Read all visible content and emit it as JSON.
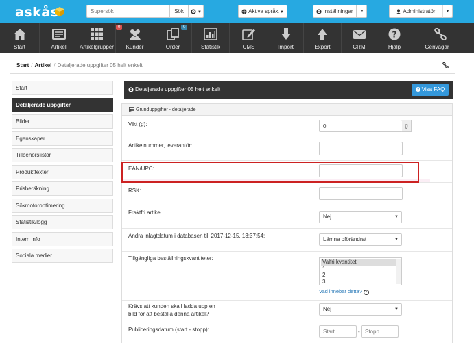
{
  "brand": {
    "name": "askås"
  },
  "topbar": {
    "search_placeholder": "Supersök",
    "search_button": "Sök",
    "language_button": "Aktiva språk",
    "settings_button": "Inställningar",
    "admin_button": "Administratör"
  },
  "nav": {
    "items": [
      {
        "label": "Start",
        "icon": "home-icon"
      },
      {
        "label": "Artikel",
        "icon": "article-icon"
      },
      {
        "label": "Artikelgrupper",
        "icon": "grid-icon"
      },
      {
        "label": "Kunder",
        "icon": "customers-icon",
        "badge": "0"
      },
      {
        "label": "Order",
        "icon": "orders-icon",
        "badge": "0"
      },
      {
        "label": "Statistik",
        "icon": "chart-icon"
      },
      {
        "label": "CMS",
        "icon": "edit-icon"
      },
      {
        "label": "Import",
        "icon": "import-arrow-icon"
      },
      {
        "label": "Export",
        "icon": "export-arrow-icon"
      },
      {
        "label": "CRM",
        "icon": "envelope-icon"
      },
      {
        "label": "Hjälp",
        "icon": "help-icon"
      },
      {
        "label": "Genvägar",
        "icon": "link-icon"
      }
    ],
    "badge_colors": {
      "kunder": "#d9534f",
      "order": "#3a87ad"
    }
  },
  "breadcrumb": {
    "start": "Start",
    "article": "Artikel",
    "separator": "/",
    "current": "Detaljerade uppgifter 05 helt enkelt"
  },
  "sidebar": {
    "items": [
      {
        "label": "Start"
      },
      {
        "label": "Detaljerade uppgifter",
        "active": true
      },
      {
        "label": "Bilder"
      },
      {
        "label": "Egenskaper"
      },
      {
        "label": "Tillbehörslistor"
      },
      {
        "label": "Produkttexter"
      },
      {
        "label": "Prisberäkning"
      },
      {
        "label": "Sökmotoroptimering"
      },
      {
        "label": "Statistik/logg"
      },
      {
        "label": "Intern info"
      },
      {
        "label": "Sociala medier"
      }
    ]
  },
  "main": {
    "header_title": "Detaljerade uppgifter 05 helt enkelt",
    "faq_button": "Visa FAQ",
    "section_title": "Grunduppgifter - detaljerade",
    "fields": {
      "weight": {
        "label": "Vikt (g):",
        "value": "0",
        "unit": "g"
      },
      "article_number": {
        "label": "Artikelnummer, leverantör:",
        "value": ""
      },
      "ean": {
        "label": "EAN/UPC:",
        "value": ""
      },
      "rsk": {
        "label": "RSK:",
        "value": ""
      },
      "free_shipping": {
        "label": "Fraktfri artikel",
        "value": "Nej"
      },
      "change_date": {
        "label": "Ändra inlagtdatum i databasen till 2017-12-15, 13:37:54:",
        "value": "Lämna oförändrat"
      },
      "quantities": {
        "label": "Tillgängliga beställningskvantiteter:",
        "options": [
          "Valfri kvantitet",
          "1",
          "2",
          "3"
        ],
        "selected": "Valfri kvantitet",
        "help_link": "Vad innebär detta?"
      },
      "upload": {
        "label_line1": "Krävs att kunden skall ladda upp en",
        "label_line2": "bild för att beställa denna artikel?",
        "value": "Nej"
      },
      "publish": {
        "label": "Publiceringsdatum (start - stopp):",
        "start_placeholder": "Start",
        "stop_placeholder": "Stopp",
        "separator": "-"
      }
    }
  },
  "colors": {
    "topbar": "#27a9e1",
    "nav": "#333333",
    "faq": "#3498db",
    "highlight": "#cc2222"
  }
}
